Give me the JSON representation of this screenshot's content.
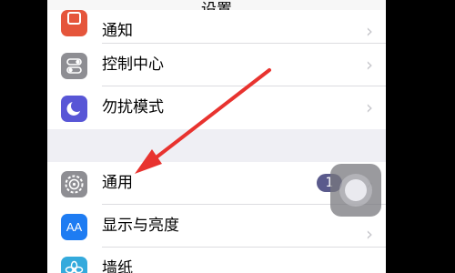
{
  "navbar": {
    "title": "设置"
  },
  "group1": {
    "items": [
      {
        "label": "通知",
        "icon": "notifications-icon",
        "color": "#e5553b"
      },
      {
        "label": "控制中心",
        "icon": "control-center-icon",
        "color": "#8e8e93"
      },
      {
        "label": "勿扰模式",
        "icon": "moon-icon",
        "color": "#5856d6"
      }
    ]
  },
  "group2": {
    "items": [
      {
        "label": "通用",
        "icon": "gear-icon",
        "color": "#8e8e93",
        "badge": "1"
      },
      {
        "label": "显示与亮度",
        "icon": "display-brightness-icon",
        "color": "#1e7cf2",
        "icon_text": "AA"
      },
      {
        "label": "墙纸",
        "icon": "wallpaper-icon",
        "color": "#34aadc"
      }
    ]
  },
  "chevron": "›",
  "annotation": {
    "color": "#e8332f"
  }
}
